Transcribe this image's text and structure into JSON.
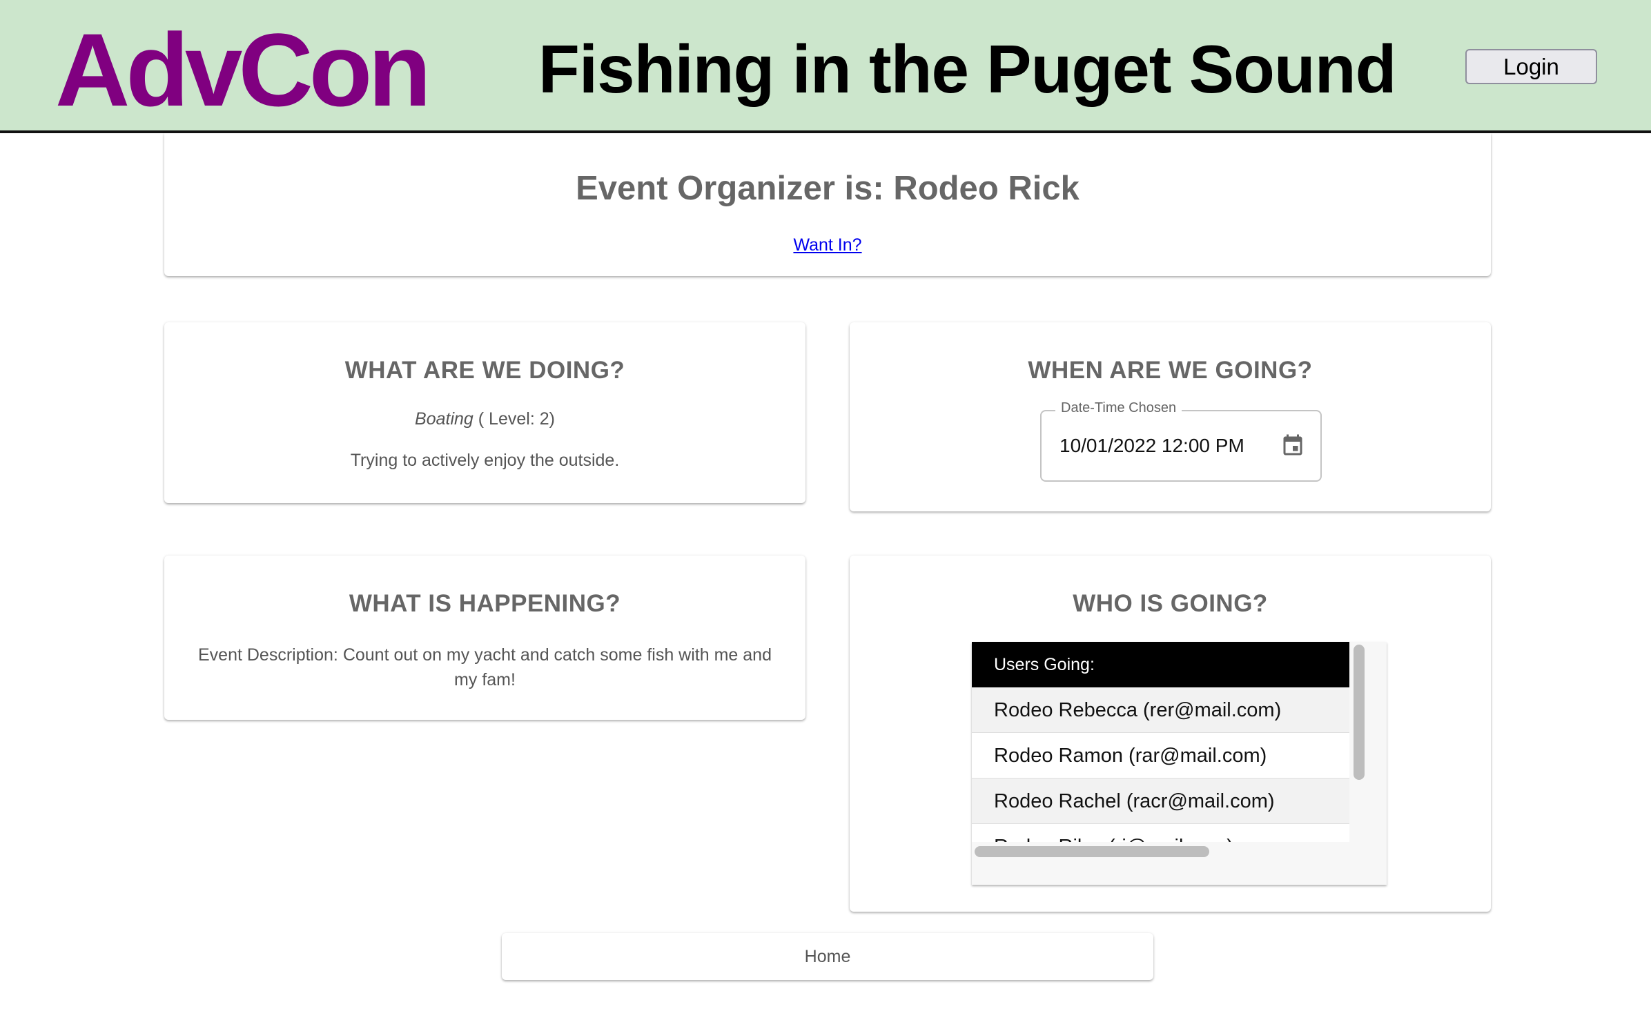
{
  "header": {
    "brand": "AdvCon",
    "title": "Fishing in the Puget Sound",
    "login_label": "Login"
  },
  "organizer": {
    "heading": "Event Organizer is: Rodeo Rick",
    "join_link": "Want In?"
  },
  "doing": {
    "heading": "WHAT ARE WE DOING?",
    "activity": "Boating",
    "level": "( Level: 2)",
    "summary": "Trying to actively enjoy the outside."
  },
  "when": {
    "heading": "WHEN ARE WE GOING?",
    "field_label": "Date-Time Chosen",
    "field_value": "10/01/2022 12:00 PM",
    "icon": "calendar-icon"
  },
  "happening": {
    "heading": "WHAT IS HAPPENING?",
    "description": "Event Description: Count out on my yacht and catch some fish with me and my fam!"
  },
  "who": {
    "heading": "WHO IS GOING?",
    "column_header": "Users Going:",
    "users": [
      "Rodeo Rebecca (rer@mail.com)",
      "Rodeo Ramon (rar@mail.com)",
      "Rodeo Rachel (racr@mail.com)",
      "Rodeo Riley (ri@mail.com)"
    ]
  },
  "footer": {
    "home_label": "Home"
  },
  "colors": {
    "header_bg": "#cce6cc",
    "brand": "#800080",
    "link": "#0000ee"
  }
}
